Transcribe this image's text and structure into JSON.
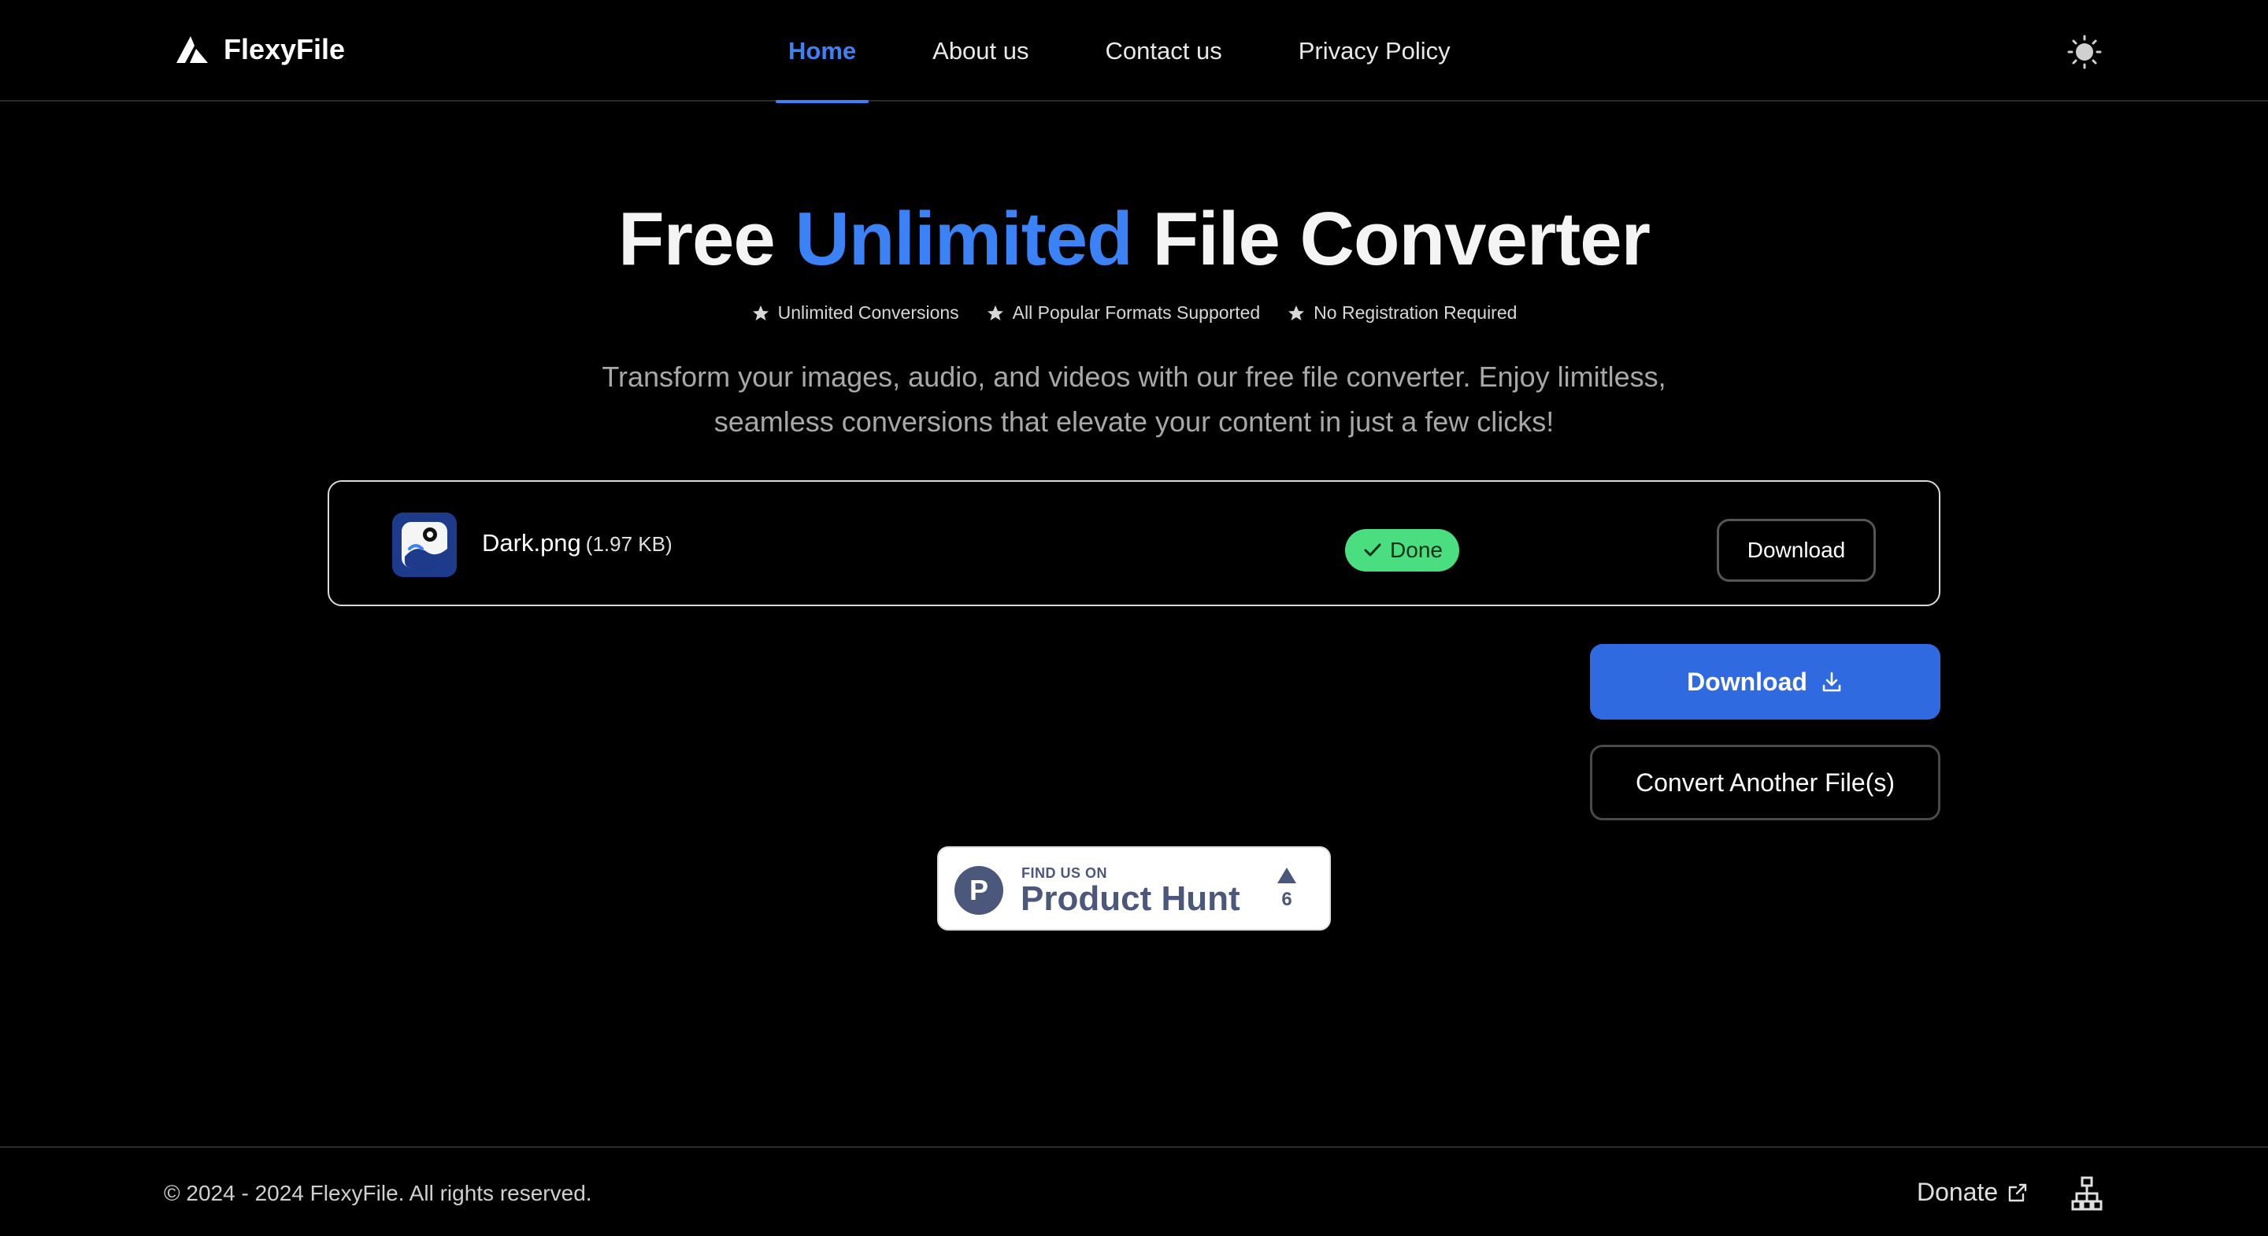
{
  "brand": {
    "name": "FlexyFile",
    "logo_icon": "triangle-logo-icon"
  },
  "nav": {
    "items": [
      {
        "label": "Home",
        "active": true
      },
      {
        "label": "About us",
        "active": false
      },
      {
        "label": "Contact us",
        "active": false
      },
      {
        "label": "Privacy Policy",
        "active": false
      }
    ],
    "theme_icon": "sun-icon"
  },
  "hero": {
    "title_part1": "Free ",
    "title_accent": "Unlimited",
    "title_part2": " File Converter",
    "features": [
      "Unlimited Conversions",
      "All Popular Formats Supported",
      "No Registration Required"
    ],
    "description": "Transform your images, audio, and videos with our free file converter. Enjoy limitless, seamless conversions that elevate your content in just a few clicks!"
  },
  "file": {
    "name": "Dark.png",
    "size": "(1.97 KB)",
    "status": "Done",
    "download_label": "Download"
  },
  "actions": {
    "download_all_label": "Download",
    "convert_another_label": "Convert Another File(s)"
  },
  "product_hunt": {
    "small_text": "FIND US ON",
    "big_text": "Product Hunt",
    "upvotes": "6",
    "logo_letter": "P"
  },
  "footer": {
    "copyright": "© 2024 - 2024 FlexyFile. All rights reserved.",
    "donate_label": "Donate"
  },
  "colors": {
    "accent": "#3b82f6",
    "primary_button": "#2f6ae0",
    "success": "#4ade80",
    "product_hunt": "#4b587c"
  }
}
